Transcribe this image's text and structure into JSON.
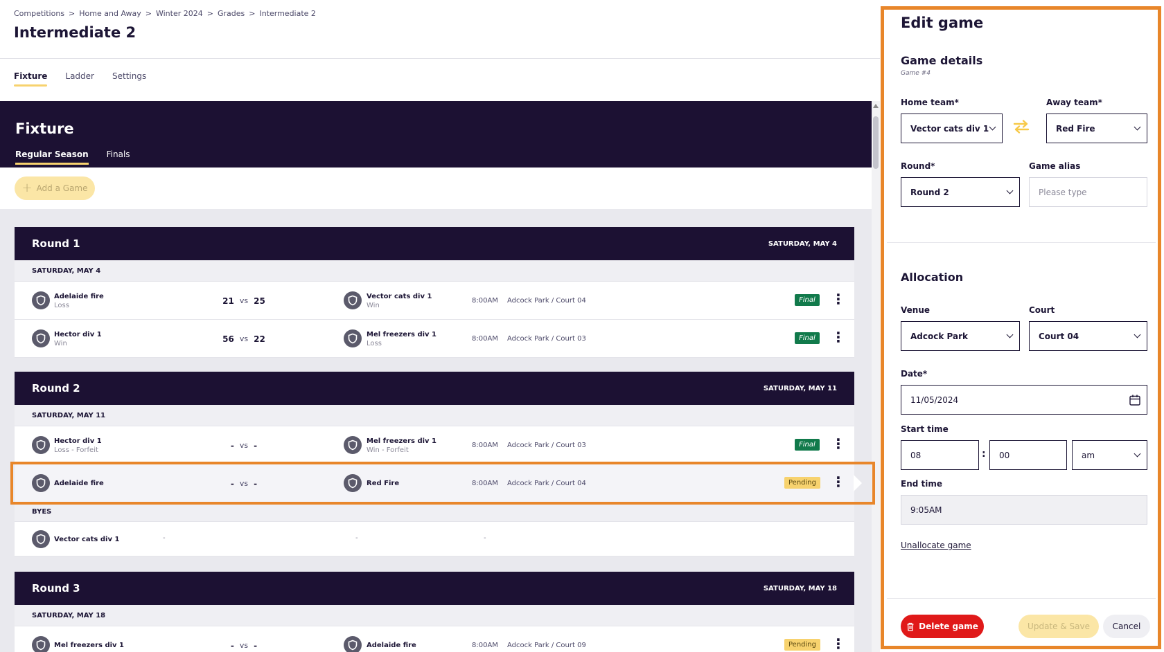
{
  "breadcrumb": [
    "Competitions",
    "Home and Away",
    "Winter 2024",
    "Grades",
    "Intermediate 2"
  ],
  "breadcrumb_sep": ">",
  "page_title": "Intermediate 2",
  "tabs": [
    "Fixture",
    "Ladder",
    "Settings"
  ],
  "fixture": {
    "title": "Fixture",
    "tabs": [
      "Regular Season",
      "Finals"
    ],
    "add_game": "Add a Game"
  },
  "rounds": [
    {
      "name": "Round 1",
      "date": "SATURDAY, MAY 4",
      "sub_date": "SATURDAY, MAY 4",
      "games": [
        {
          "home": "Adelaide fire",
          "home_result": "Loss",
          "home_score": "21",
          "vs": "vs",
          "away_score": "25",
          "away": "Vector cats div 1",
          "away_result": "Win",
          "time": "8:00AM",
          "venue": "Adcock Park / Court 04",
          "status": "Final"
        },
        {
          "home": "Hector div 1",
          "home_result": "Win",
          "home_score": "56",
          "vs": "vs",
          "away_score": "22",
          "away": "Mel freezers div 1",
          "away_result": "Loss",
          "time": "8:00AM",
          "venue": "Adcock Park / Court 03",
          "status": "Final"
        }
      ]
    },
    {
      "name": "Round 2",
      "date": "SATURDAY, MAY 11",
      "sub_date": "SATURDAY, MAY 11",
      "games": [
        {
          "home": "Hector div 1",
          "home_result": "Loss - Forfeit",
          "home_score": "-",
          "vs": "vs",
          "away_score": "-",
          "away": "Mel freezers div 1",
          "away_result": "Win - Forfeit",
          "time": "8:00AM",
          "venue": "Adcock Park / Court 03",
          "status": "Final"
        },
        {
          "home": "Adelaide fire",
          "home_result": "",
          "home_score": "-",
          "vs": "vs",
          "away_score": "-",
          "away": "Red Fire",
          "away_result": "",
          "time": "8:00AM",
          "venue": "Adcock Park / Court 04",
          "status": "Pending"
        }
      ],
      "byes_label": "BYES",
      "byes": [
        {
          "team": "Vector cats div 1",
          "dash": "-"
        }
      ]
    },
    {
      "name": "Round 3",
      "date": "SATURDAY, MAY 18",
      "sub_date": "SATURDAY, MAY 18",
      "games": [
        {
          "home": "Mel freezers div 1",
          "home_result": "",
          "home_score": "-",
          "vs": "vs",
          "away_score": "-",
          "away": "Adelaide fire",
          "away_result": "",
          "time": "8:00AM",
          "venue": "Adcock Park / Court 09",
          "status": "Pending"
        }
      ]
    }
  ],
  "panel": {
    "title": "Edit game",
    "details_title": "Game details",
    "game_number": "Game #4",
    "home_label": "Home team*",
    "home_value": "Vector cats div 1",
    "away_label": "Away team*",
    "away_value": "Red Fire",
    "round_label": "Round*",
    "round_value": "Round 2",
    "alias_label": "Game alias",
    "alias_placeholder": "Please type",
    "allocation_title": "Allocation",
    "venue_label": "Venue",
    "venue_value": "Adcock Park",
    "court_label": "Court",
    "court_value": "Court 04",
    "date_label": "Date*",
    "date_value": "11/05/2024",
    "start_label": "Start time",
    "start_hour": "08",
    "start_colon": ":",
    "start_min": "00",
    "start_ampm": "am",
    "end_label": "End time",
    "end_value": "9:05AM",
    "unallocate": "Unallocate game",
    "delete": "Delete game",
    "update": "Update & Save",
    "cancel": "Cancel"
  },
  "colors": {
    "navy": "#1c1133",
    "accent_yellow": "#f7d26e",
    "final_green": "#117a4b",
    "delete_red": "#e01919",
    "highlight_orange": "#e8862a"
  }
}
